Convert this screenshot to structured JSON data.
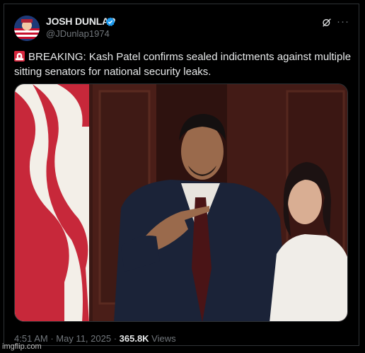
{
  "author": {
    "display_name": "JOSH DUNLAP",
    "handle": "@JDunlap1974",
    "verified_icon": "verified-badge-icon",
    "avatar_icon": "flag-avatar"
  },
  "header_actions": {
    "grok_icon": "grok-icon",
    "more_label": "···"
  },
  "tweet": {
    "emoji_icon": "siren-icon",
    "text": "BREAKING: Kash Patel confirms sealed indictments against multiple sitting senators for national security leaks."
  },
  "meta": {
    "time": "4:51 AM",
    "sep1": " · ",
    "date": "May 11, 2025",
    "sep2": " · ",
    "views_count": "365.8K",
    "views_label": " Views"
  },
  "watermark": "imgflip.com",
  "colors": {
    "background": "#000000",
    "text": "#e7e9ea",
    "muted": "#71767b",
    "verified": "#1d9bf0",
    "border": "#2f3336"
  }
}
